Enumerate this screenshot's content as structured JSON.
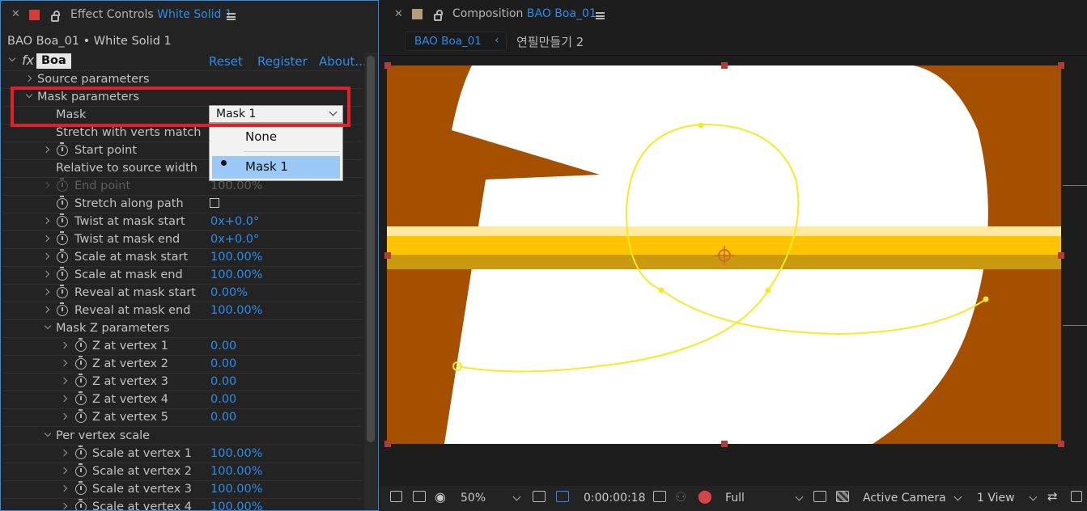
{
  "effect_controls": {
    "tab_prefix": "Effect Controls",
    "tab_layer": "White Solid 1",
    "layer_path": "BAO Boa_01 • White Solid 1",
    "fx_label": "fx",
    "effect_name": "Boa",
    "reset": "Reset",
    "register": "Register",
    "about": "About...",
    "rows": {
      "source_params": "Source parameters",
      "mask_params": "Mask parameters",
      "mask": "Mask",
      "stretch_verts": "Stretch with verts match",
      "start_point": "Start point",
      "relative_width": "Relative to source width",
      "end_point": "End point",
      "end_point_val": "100.00%",
      "stretch_path": "Stretch along path",
      "twist_start": "Twist at mask start",
      "twist_start_val": "0x+0.0°",
      "twist_end": "Twist at mask end",
      "twist_end_val": "0x+0.0°",
      "scale_start": "Scale at mask start",
      "scale_start_val": "100.00%",
      "scale_end": "Scale at mask end",
      "scale_end_val": "100.00%",
      "reveal_start": "Reveal at mask start",
      "reveal_start_val": "0.00%",
      "reveal_end": "Reveal at mask end",
      "reveal_end_val": "100.00%",
      "mask_z": "Mask Z parameters",
      "z1": "Z at vertex 1",
      "z1_val": "0.00",
      "z2": "Z at vertex 2",
      "z2_val": "0.00",
      "z3": "Z at vertex 3",
      "z3_val": "0.00",
      "z4": "Z at vertex 4",
      "z4_val": "0.00",
      "z5": "Z at vertex 5",
      "z5_val": "0.00",
      "per_vertex": "Per vertex scale",
      "s1": "Scale at vertex 1",
      "s1_val": "100.00%",
      "s2": "Scale at vertex 2",
      "s2_val": "100.00%",
      "s3": "Scale at vertex 3",
      "s3_val": "100.00%",
      "s4": "Scale at vertex 4",
      "s4_val": "100.00%"
    },
    "mask_dropdown": {
      "selected": "Mask 1",
      "options": [
        "None",
        "Mask 1"
      ]
    }
  },
  "composition": {
    "tab_prefix": "Composition",
    "tab_name": "BAO Boa_01",
    "breadcrumb_active": "BAO Boa_01",
    "breadcrumb_next": "연필만들기 2"
  },
  "viewer_bar": {
    "zoom": "50%",
    "timecode": "0:00:00:18",
    "resolution": "Full",
    "camera": "Active Camera",
    "views": "1 View"
  },
  "colors": {
    "accent": "#2d8ceb",
    "highlight_box": "#e0202b",
    "comp_bg": "#a55000",
    "mask_path": "#f5e92a",
    "selection": "#99c9f4"
  }
}
